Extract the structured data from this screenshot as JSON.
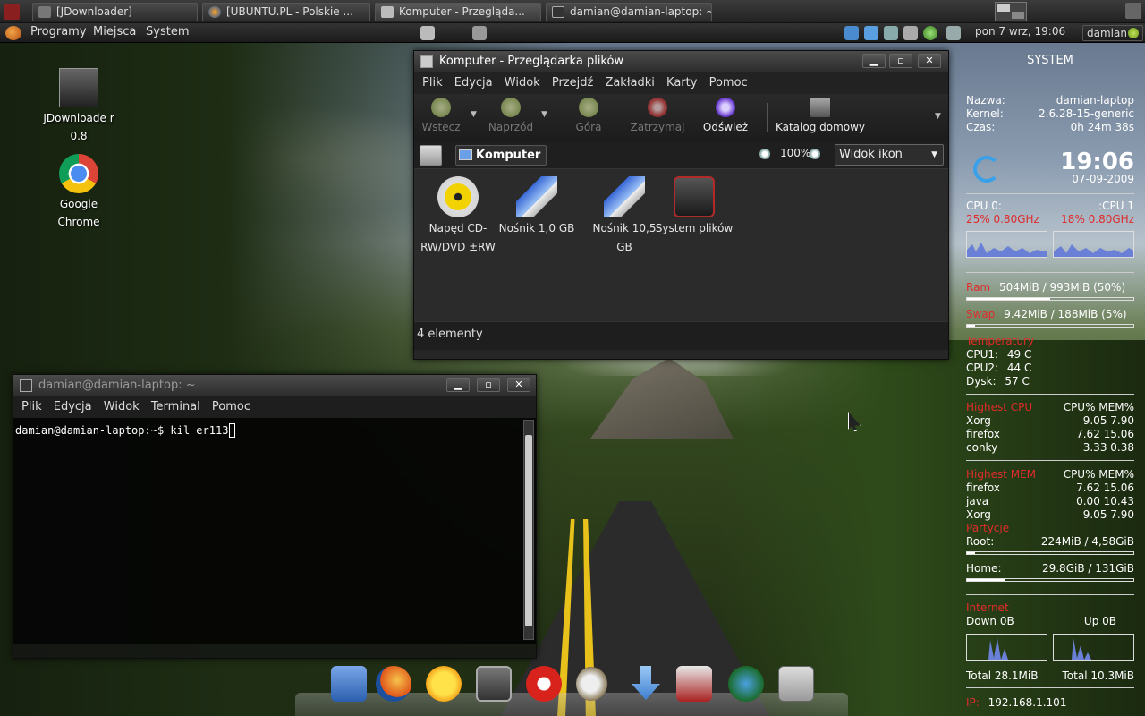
{
  "taskbar": {
    "tasks": [
      {
        "label": "[JDownloader]"
      },
      {
        "label": "[UBUNTU.PL - Polskie ..."
      },
      {
        "label": "Komputer - Przegląda..."
      },
      {
        "label": "damian@damian-laptop: ~"
      }
    ]
  },
  "panel": {
    "menus": [
      "Programy",
      "Miejsca",
      "System"
    ],
    "clock": "pon 7 wrz, 19:06",
    "user": "damian"
  },
  "desktop": {
    "icons": [
      {
        "label": "JDownloade r 0.8",
        "icon": "jdownloader-icon"
      },
      {
        "label": "Google Chrome",
        "icon": "chrome-icon"
      }
    ]
  },
  "nautilus": {
    "title": "Komputer - Przeglądarka plików",
    "menu": [
      "Plik",
      "Edycja",
      "Widok",
      "Przejdź",
      "Zakładki",
      "Karty",
      "Pomoc"
    ],
    "toolbar": {
      "back": "Wstecz",
      "forward": "Naprzód",
      "up": "Góra",
      "stop": "Zatrzymaj",
      "reload": "Odśwież",
      "home": "Katalog domowy"
    },
    "location": "Komputer",
    "zoom": "100%",
    "view_mode": "Widok ikon",
    "items": [
      {
        "label": "Napęd CD-RW/DVD ±RW",
        "icon": "cdrom-icon"
      },
      {
        "label": "Nośnik 1,0 GB",
        "icon": "usb-drive-icon"
      },
      {
        "label": "Nośnik 10,5 GB",
        "icon": "usb-drive-icon"
      },
      {
        "label": "System plików",
        "icon": "harddisk-icon"
      }
    ],
    "status": "4 elementy"
  },
  "terminal": {
    "title": "damian@damian-laptop: ~",
    "menu": [
      "Plik",
      "Edycja",
      "Widok",
      "Terminal",
      "Pomoc"
    ],
    "line": "damian@damian-laptop:~$ kil er113"
  },
  "conky": {
    "header": "SYSTEM",
    "name_label": "Nazwa:",
    "name": "damian-laptop",
    "kernel_label": "Kernel:",
    "kernel": "2.6.28-15-generic",
    "uptime_label": "Czas:",
    "uptime": "0h 24m 38s",
    "time": "19:06",
    "date": "07-09-2009",
    "cpu0_label": "CPU 0:",
    "cpu1_label": ":CPU 1",
    "cpu0_value": "25% 0.80GHz",
    "cpu1_value": "18% 0.80GHz",
    "ram_label": "Ram",
    "ram_value": "504MiB / 993MiB (50%)",
    "ram_pct": 50,
    "swap_label": "Swap",
    "swap_value": "9.42MiB / 188MiB (5%)",
    "swap_pct": 5,
    "temp_header": "Temperatury",
    "temps": [
      {
        "label": "CPU1:",
        "value": "49 C"
      },
      {
        "label": "CPU2:",
        "value": "44 C"
      },
      {
        "label": "Dysk:",
        "value": "57 C"
      }
    ],
    "top_cpu_header": "Highest CPU",
    "top_mem_header": "Highest MEM",
    "cols_header": "CPU% MEM%",
    "top_cpu": [
      {
        "name": "Xorg",
        "value": "9.05 7.90"
      },
      {
        "name": "firefox",
        "value": "7.62 15.06"
      },
      {
        "name": "conky",
        "value": "3.33 0.38"
      }
    ],
    "top_mem": [
      {
        "name": "firefox",
        "value": "7.62 15.06"
      },
      {
        "name": "java",
        "value": "0.00 10.43"
      },
      {
        "name": "Xorg",
        "value": "9.05 7.90"
      }
    ],
    "fs_header": "Partycje",
    "root_label": "Root:",
    "root_value": "224MiB / 4,58GiB",
    "root_pct": 5,
    "home_label": "Home:",
    "home_value": "29.8GiB / 131GiB",
    "home_pct": 23,
    "net_header": "Internet",
    "down_label": "Down 0B",
    "up_label": "Up 0B",
    "total_down": "Total 28.1MiB",
    "total_up": "Total 10.3MiB",
    "ip_label": "IP:",
    "ip": "192.168.1.101"
  },
  "dock": {
    "icons": [
      "network-icon",
      "firefox-icon",
      "weather-icon",
      "terminal-icon",
      "napi-icon",
      "gimp-icon",
      "download-icon",
      "kde-icon",
      "globe-icon",
      "file-cabinet-icon"
    ]
  },
  "colors": {
    "conky_red": "#e02b2b",
    "window_bg": "#262626",
    "road_line": "#e8c21a"
  }
}
